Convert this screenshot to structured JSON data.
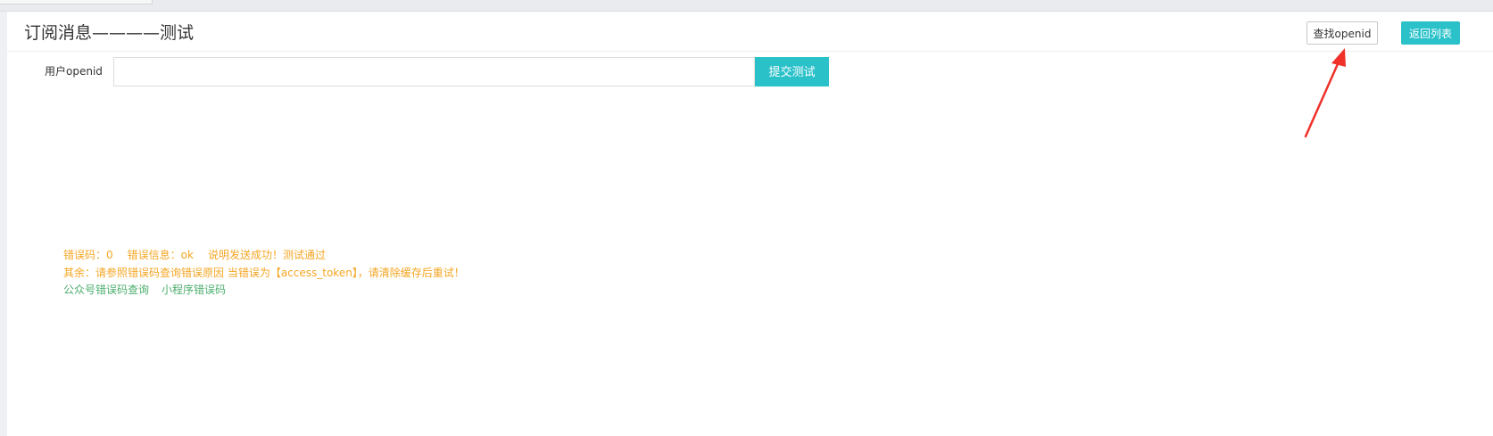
{
  "page": {
    "title": "订阅消息————测试"
  },
  "toolbar": {
    "find_openid_label": "查找openid",
    "back_label": "返回列表"
  },
  "form": {
    "openid_label": "用户openid",
    "openid_value": "",
    "openid_placeholder": "",
    "submit_label": "提交测试"
  },
  "result": {
    "error_code_label": "错误码：",
    "error_code_value": "0",
    "error_msg_label": "错误信息：",
    "error_msg_value": "ok",
    "explain_text": "说明发送成功！测试通过",
    "other_text": "其余：请参照错误码查询错误原因 当错误为【access_token】，请清除缓存后重试！",
    "links": [
      {
        "label": "公众号错误码查询"
      },
      {
        "label": "小程序错误码"
      }
    ]
  },
  "colors": {
    "accent": "#2ac1c9",
    "warning_text": "#f5a623",
    "link_text": "#4cae6e",
    "annotation_arrow": "#f0312a"
  }
}
